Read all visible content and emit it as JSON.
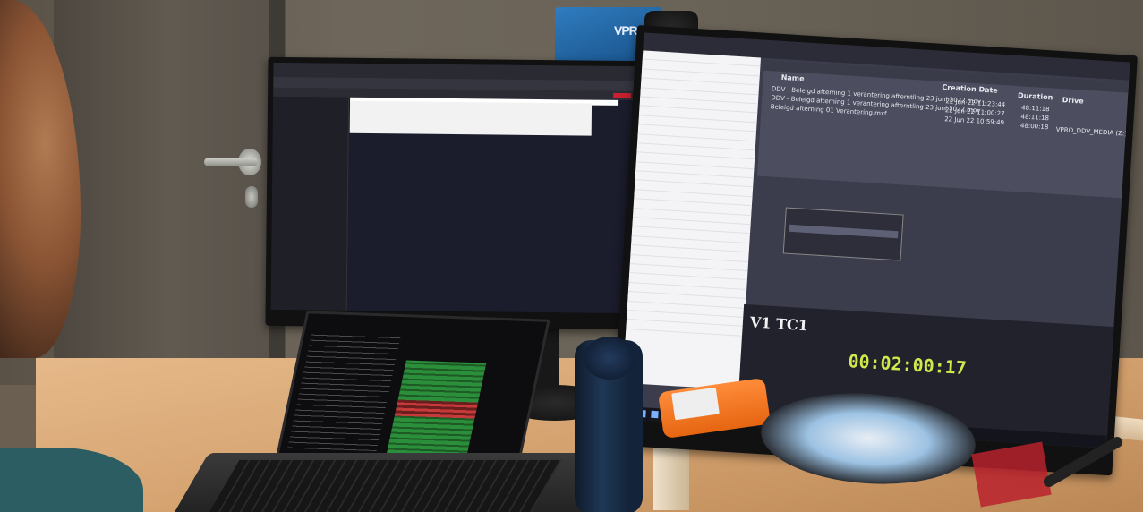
{
  "sticker": {
    "text": "VPRO"
  },
  "right_monitor": {
    "bin_columns": {
      "name": "Name",
      "creation_date": "Creation Date",
      "duration": "Duration",
      "drive": "Drive"
    },
    "bin_rows": [
      {
        "name": "DDV - Beleigd afterning 1 verantering afterntling 23 juni 2022.mov",
        "date": "22 Jun 22 11:23:44",
        "duration": "48:11:18"
      },
      {
        "name": "DDV - Beleigd afterning 1 verantering afterntling 23 juni 2022.mov",
        "date": "22 Jun 22 11:00:27",
        "duration": "48:11:18"
      },
      {
        "name": "Beleigd afterning 01 Verantering.mxf",
        "date": "22 Jun 22 10:59:49",
        "duration": "48:00:18",
        "drive": "VPRO_DDV_MEDIA (Z:)"
      }
    ],
    "track_label": "V1  TC1",
    "timecode": "00:02:00:17"
  }
}
